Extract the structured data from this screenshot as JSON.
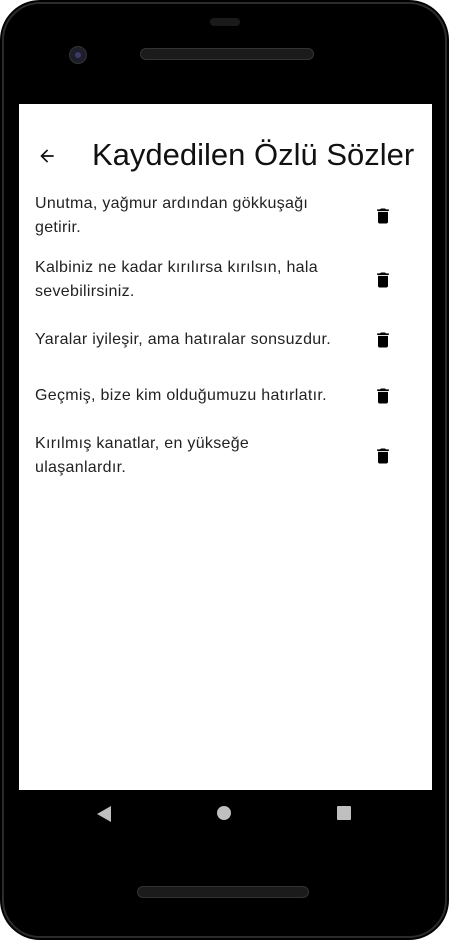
{
  "appbar": {
    "title": "Kaydedilen Özlü Sözler",
    "back_icon": "arrow-back-icon"
  },
  "quotes": [
    {
      "text": "Unutma, yağmur ardından gökkuşağı getirir.",
      "icon": "trash-icon"
    },
    {
      "text": "Kalbiniz ne kadar kırılırsa kırılsın, hala sevebilirsiniz.",
      "icon": "trash-icon"
    },
    {
      "text": "Yaralar iyileşir, ama hatıralar sonsuzdur.",
      "icon": "trash-icon"
    },
    {
      "text": "Geçmiş, bize kim olduğumuzu hatırlatır.",
      "icon": "trash-icon"
    },
    {
      "text": "Kırılmış kanatlar, en yükseğe ulaşanlardır.",
      "icon": "trash-icon"
    }
  ],
  "navbar": {
    "back_icon": "nav-back-icon",
    "home_icon": "nav-home-icon",
    "recents_icon": "nav-recents-icon"
  }
}
